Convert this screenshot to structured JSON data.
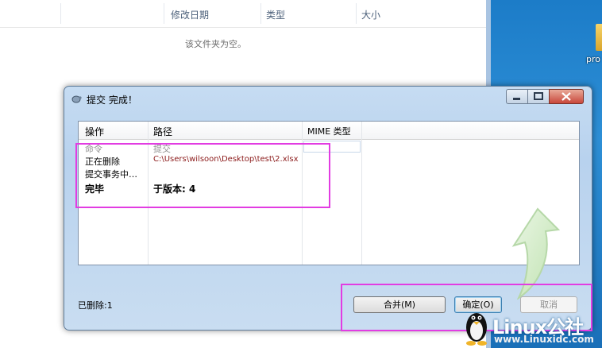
{
  "explorer": {
    "col_modified": "修改日期",
    "col_type": "类型",
    "col_size": "大小",
    "empty_message": "该文件夹为空。"
  },
  "desktop": {
    "icon_label": "pro"
  },
  "dialog": {
    "title": "提交 完成！",
    "columns": [
      "操作",
      "路径",
      "MIME 类型"
    ],
    "rows": [
      {
        "action": "命令",
        "path": "提交"
      },
      {
        "action": "正在删除",
        "path": "C:\\Users\\wilsoon\\Desktop\\test\\2.xlsx"
      },
      {
        "action": "提交事务中…",
        "path": ""
      },
      {
        "action": "完毕",
        "path": "于版本: 4"
      }
    ],
    "status": "已删除:1",
    "buttons": {
      "merge": "合并(M)",
      "ok": "确定(O)",
      "cancel": "取消"
    }
  },
  "watermark": {
    "brand": "Linux公社",
    "url": "www.Linuxidc.com"
  },
  "colors": {
    "highlight_box": "#e23ce2",
    "error_path": "#8b1a1a"
  }
}
